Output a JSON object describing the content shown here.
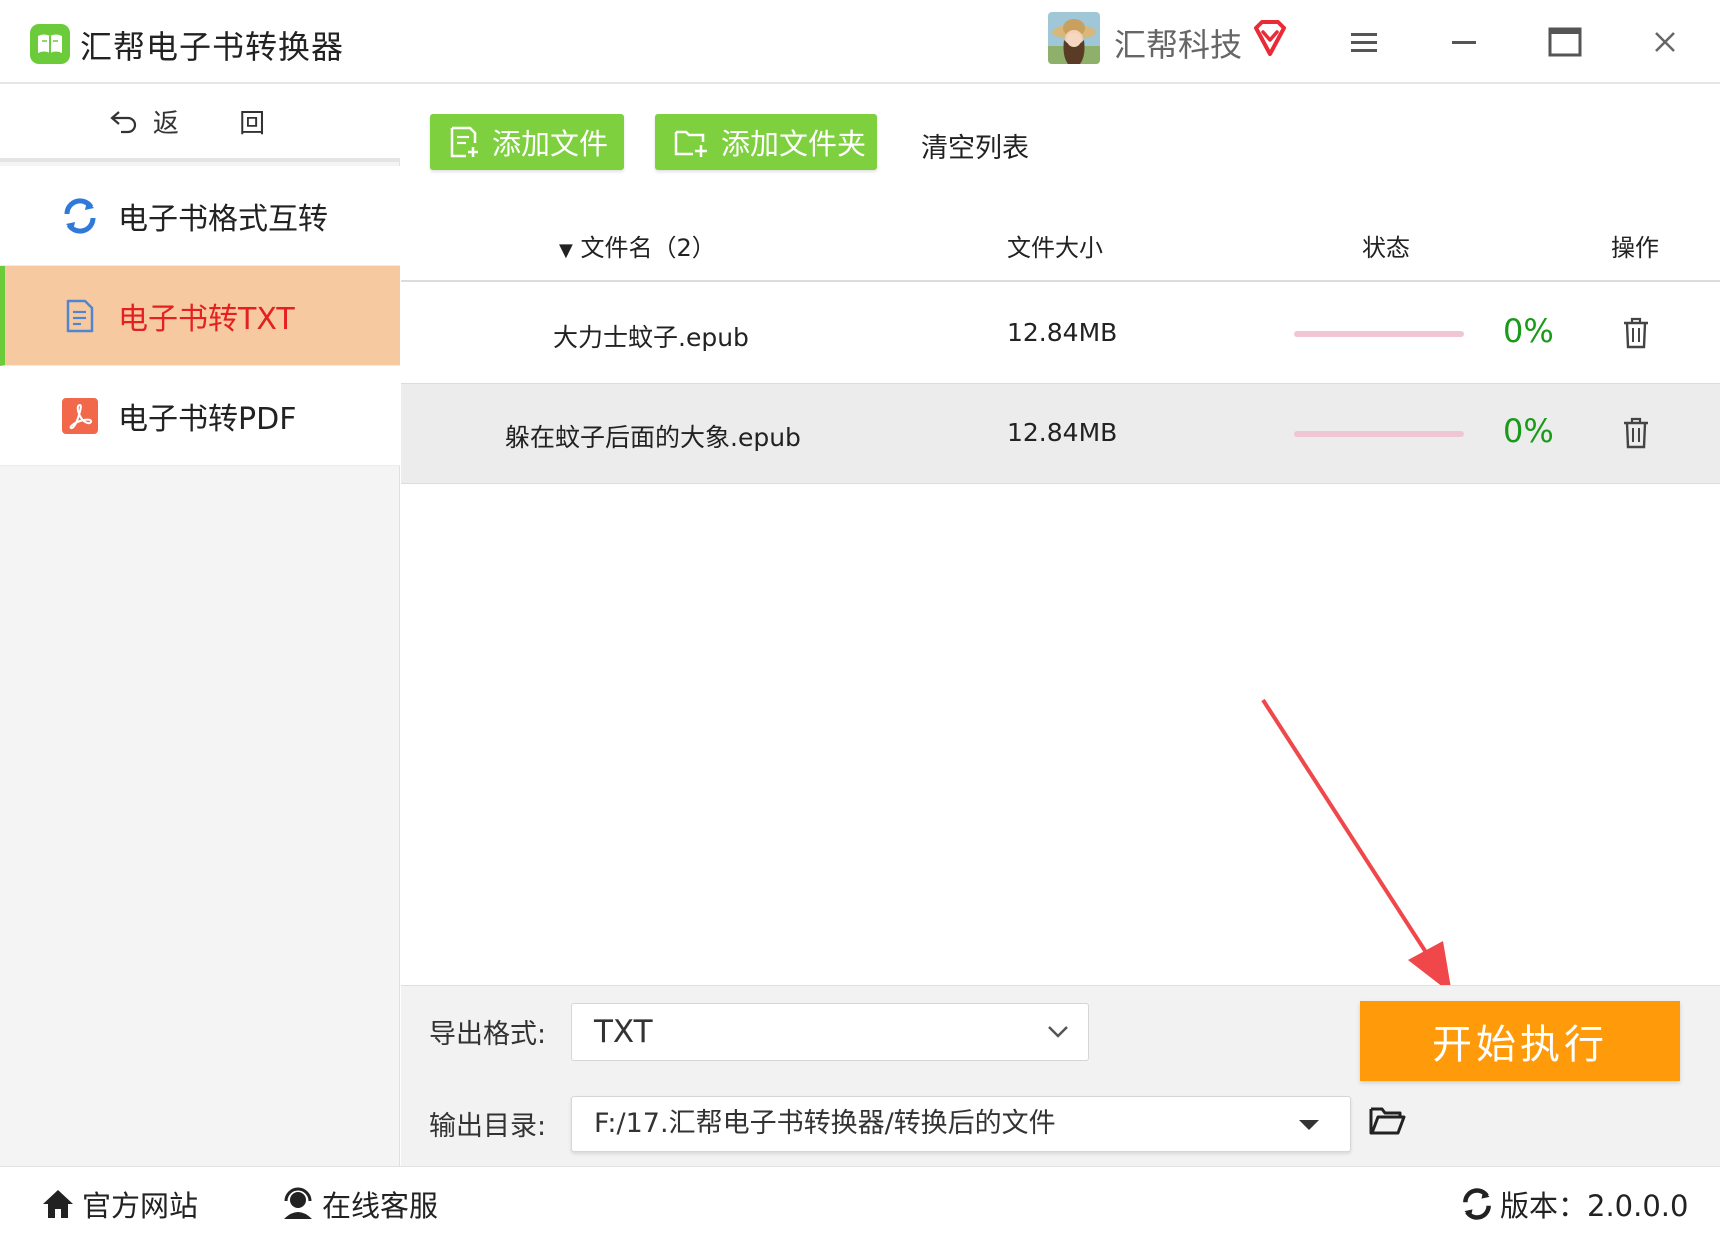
{
  "window": {
    "title": "汇帮电子书转换器",
    "user_name": "汇帮科技",
    "accent_green": "#6ccb3a",
    "accent_orange": "#ff9a0b"
  },
  "sidebar": {
    "back_label": "返 回",
    "items": [
      {
        "label": "电子书格式互转",
        "icon": "refresh-icon"
      },
      {
        "label": "电子书转TXT",
        "icon": "document-icon",
        "active": true
      },
      {
        "label": "电子书转PDF",
        "icon": "pdf-icon"
      }
    ]
  },
  "toolbar": {
    "add_file": "添加文件",
    "add_folder": "添加文件夹",
    "clear_list": "清空列表"
  },
  "table": {
    "columns": [
      "文件名（2）",
      "文件大小",
      "状态",
      "操作"
    ],
    "rows": [
      {
        "name": "大力士蚊子.epub",
        "size": "12.84MB",
        "progress": 0,
        "progress_text": "0%"
      },
      {
        "name": "躲在蚊子后面的大象.epub",
        "size": "12.84MB",
        "progress": 0,
        "progress_text": "0%"
      }
    ]
  },
  "export": {
    "format_label": "导出格式:",
    "format_value": "TXT",
    "dir_label": "输出目录:",
    "dir_value": "F:/17.汇帮电子书转换器/转换后的文件",
    "start_label": "开始执行"
  },
  "statusbar": {
    "website": "官方网站",
    "support": "在线客服",
    "version": "版本：2.0.0.0"
  }
}
